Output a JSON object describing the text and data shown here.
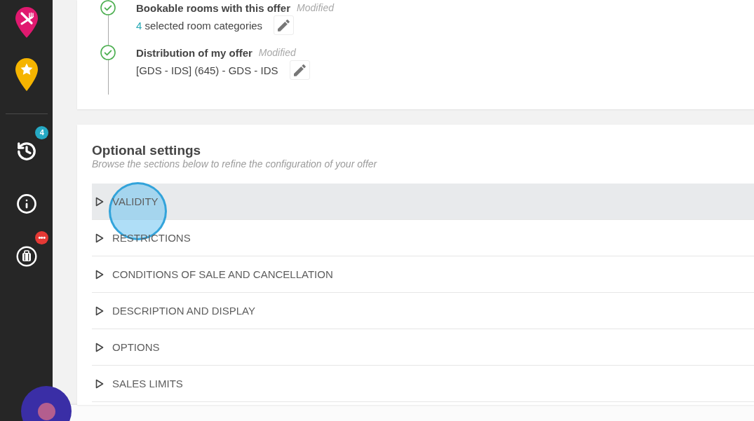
{
  "sidebar": {
    "apps": [
      {
        "kind": "restaurant"
      },
      {
        "kind": "favorites"
      }
    ],
    "tools": [
      {
        "kind": "history",
        "badge": {
          "text": "4",
          "color": "#26a9c4"
        }
      },
      {
        "kind": "info"
      },
      {
        "kind": "luggage",
        "badge": {
          "text": "•••",
          "color": "#e53935"
        }
      }
    ]
  },
  "timeline": {
    "steps": [
      {
        "title": "Bookable rooms with this offer",
        "status": "Modified",
        "count": "4",
        "value": "selected room categories",
        "done": true
      },
      {
        "title": "Distribution of my offer",
        "status": "Modified",
        "value": "[GDS - IDS] (645) - GDS - IDS",
        "done": true
      }
    ]
  },
  "optional_settings": {
    "title": "Optional settings",
    "subtitle": "Browse the sections below to refine the configuration of your offer",
    "sections": [
      {
        "label": "VALIDITY",
        "selected": true,
        "expanded": false
      },
      {
        "label": "RESTRICTIONS",
        "selected": false,
        "expanded": false
      },
      {
        "label": "CONDITIONS OF SALE AND CANCELLATION",
        "selected": false,
        "expanded": false
      },
      {
        "label": "DESCRIPTION AND DISPLAY",
        "selected": false,
        "expanded": false
      },
      {
        "label": "OPTIONS",
        "selected": false,
        "expanded": false
      },
      {
        "label": "SALES LIMITS",
        "selected": false,
        "expanded": false
      }
    ]
  }
}
